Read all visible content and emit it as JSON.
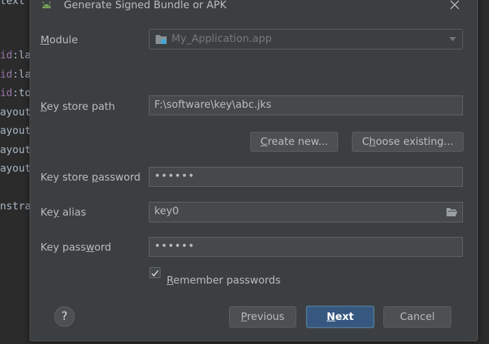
{
  "editor": {
    "lines": [
      {
        "kw": "",
        "text": "text"
      },
      {
        "kw": "id",
        "text": ":la"
      },
      {
        "kw": "id",
        "text": ":la"
      },
      {
        "kw": "id",
        "text": ":to"
      },
      {
        "kw": "",
        "text": "ayout"
      },
      {
        "kw": "",
        "text": "ayout"
      },
      {
        "kw": "",
        "text": "ayout"
      },
      {
        "kw": "",
        "text": "ayout"
      },
      {
        "kw": "",
        "text": "nstra"
      }
    ]
  },
  "dialog": {
    "title": "Generate Signed Bundle or APK",
    "module": {
      "label_pre": "",
      "label_u": "M",
      "label_post": "odule",
      "value": "My_Application.app"
    },
    "keystore_path": {
      "label_pre": "",
      "label_u": "K",
      "label_post": "ey store path",
      "value": "F:\\software\\key\\abc.jks"
    },
    "create_new": {
      "pre": "",
      "u": "C",
      "post": "reate new..."
    },
    "choose_existing": {
      "pre": "C",
      "u": "h",
      "post": "oose existing..."
    },
    "keystore_password": {
      "label_pre": "Key store ",
      "label_u": "p",
      "label_post": "assword",
      "value": "••••••"
    },
    "key_alias": {
      "label_pre": "Ke",
      "label_u": "y",
      "label_post": " alias",
      "value": "key0"
    },
    "key_password": {
      "label_pre": "Key pass",
      "label_u": "w",
      "label_post": "ord",
      "value": "••••••"
    },
    "remember": {
      "checked": true,
      "pre": "",
      "u": "R",
      "post": "emember passwords"
    },
    "buttons": {
      "help": "?",
      "previous": {
        "pre": "",
        "u": "P",
        "post": "revious"
      },
      "next": {
        "pre": "",
        "u": "N",
        "post": "ext"
      },
      "cancel": "Cancel"
    }
  },
  "colors": {
    "dialog_bg": "#3c3f41",
    "primary_button": "#365880",
    "field_bg": "#45494a"
  }
}
